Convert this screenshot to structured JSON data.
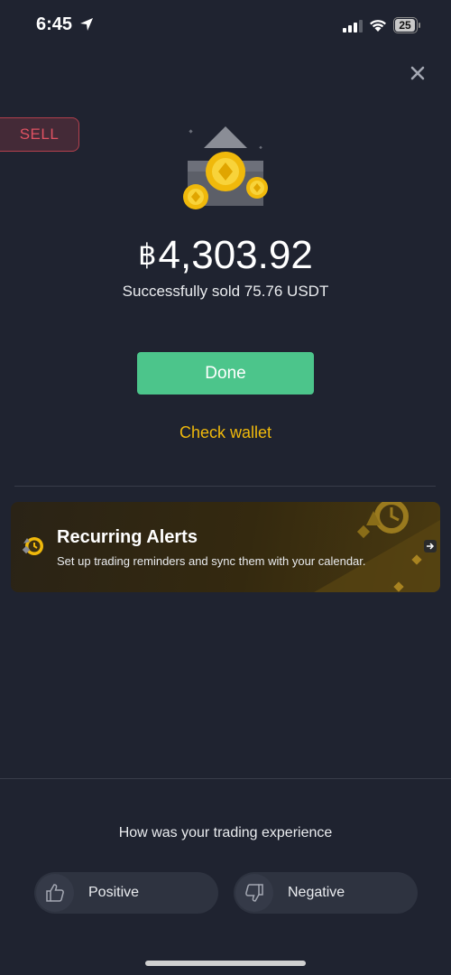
{
  "status_bar": {
    "time": "6:45",
    "battery": "25"
  },
  "order": {
    "side_badge": "SELL",
    "currency_symbol": "฿",
    "amount": "4,303.92",
    "success_message": "Successfully sold 75.76 USDT"
  },
  "actions": {
    "done_label": "Done",
    "check_wallet_label": "Check wallet"
  },
  "promo_banner": {
    "title": "Recurring Alerts",
    "description": "Set up trading reminders and sync them with your calendar."
  },
  "feedback": {
    "question": "How was your trading experience",
    "positive_label": "Positive",
    "negative_label": "Negative"
  },
  "colors": {
    "background": "#1f2330",
    "accent_yellow": "#f0b90b",
    "done_green": "#4cc58b",
    "sell_red": "#e05262"
  }
}
